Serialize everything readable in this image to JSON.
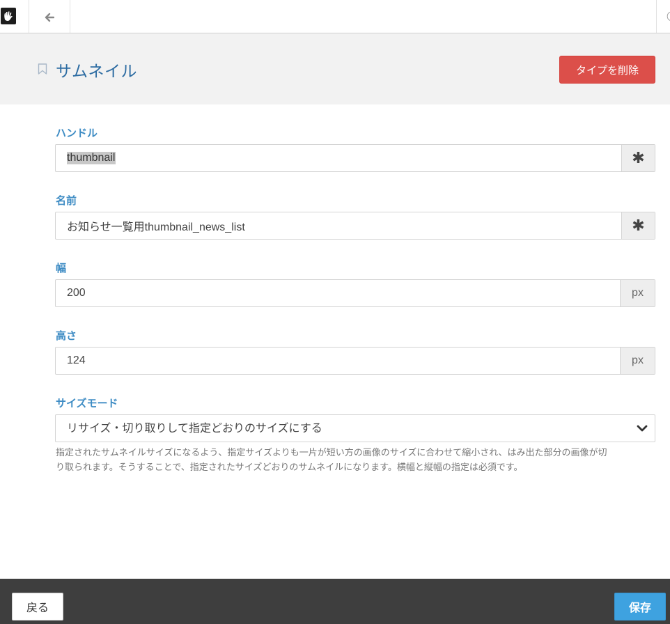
{
  "toolbar": {
    "logo_icon": "concrete5-hand-icon",
    "back_icon": "arrow-left-icon"
  },
  "header": {
    "title": "サムネイル",
    "delete_label": "タイプを削除"
  },
  "form": {
    "handle": {
      "label": "ハンドル",
      "value": "thumbnail",
      "addon": "✱"
    },
    "name": {
      "label": "名前",
      "value": "お知らせ一覧用thumbnail_news_list",
      "addon": "✱"
    },
    "width": {
      "label": "幅",
      "value": "200",
      "addon": "px"
    },
    "height": {
      "label": "高さ",
      "value": "124",
      "addon": "px"
    },
    "size_mode": {
      "label": "サイズモード",
      "selected": "リサイズ・切り取りして指定どおりのサイズにする",
      "help_line1": "指定されたサムネイルサイズになるよう、指定サイズよりも一片が短い方の画像のサイズに合わせて縮小され、はみ出た部分の画像が切",
      "help_line2": "り取られます。そうすることで、指定されたサイズどおりのサムネイルになります。横幅と縦幅の指定は必須です。"
    }
  },
  "footer": {
    "back_label": "戻る",
    "save_label": "保存"
  },
  "colors": {
    "accent": "#3e8cc4",
    "title": "#2d6ca2",
    "danger": "#dc4f4a",
    "primary": "#3ea2e0",
    "footer_bg": "#3e3e3e"
  }
}
